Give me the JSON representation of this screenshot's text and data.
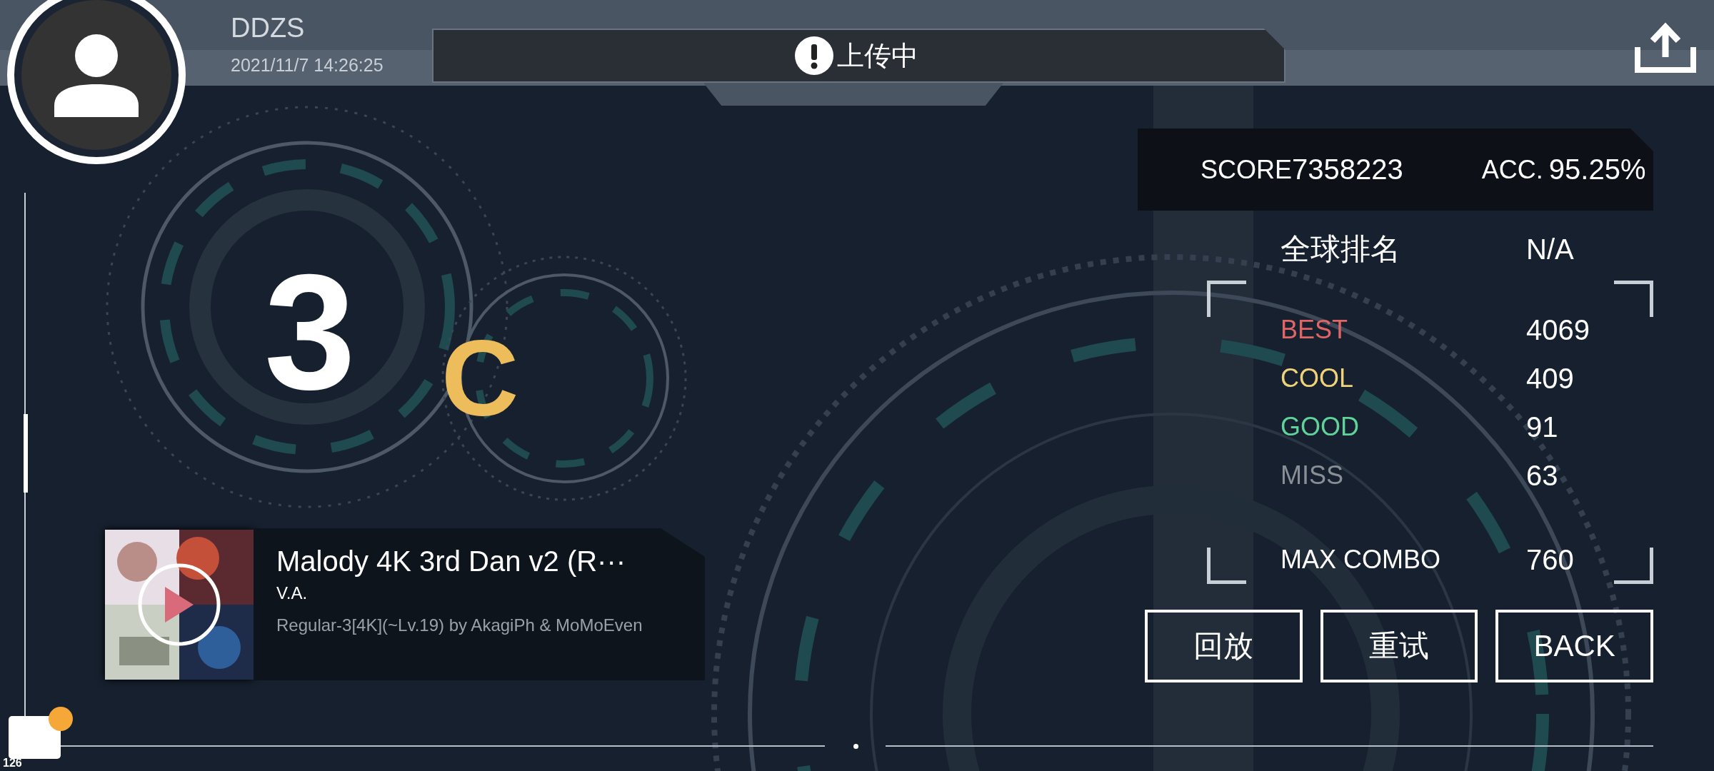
{
  "player": {
    "name": "DDZS",
    "datetime": "2021/11/7 14:26:25"
  },
  "header": {
    "notice": "上传中"
  },
  "score": {
    "label": "SCORE",
    "value": "7358223",
    "acc_label": "ACC.",
    "acc": "95.25%"
  },
  "rank": {
    "number": "3",
    "grade": "C"
  },
  "global_rank": {
    "label": "全球排名",
    "value": "N/A"
  },
  "judgements": [
    {
      "label": "BEST",
      "value": "4069",
      "color": "#e06666"
    },
    {
      "label": "COOL",
      "value": "409",
      "color": "#f0d27a"
    },
    {
      "label": "GOOD",
      "value": "91",
      "color": "#5fd39a"
    },
    {
      "label": "MISS",
      "value": "63",
      "color": "#8a8f96"
    }
  ],
  "max_combo": {
    "label": "MAX COMBO",
    "value": "760"
  },
  "song": {
    "title": "Malody 4K 3rd Dan v2 (R···",
    "artist": "V.A.",
    "chart": "Regular-3[4K](~Lv.19) by AkagiPh & MoMoEven"
  },
  "buttons": [
    "回放",
    "重试",
    "BACK"
  ],
  "badge": "126"
}
